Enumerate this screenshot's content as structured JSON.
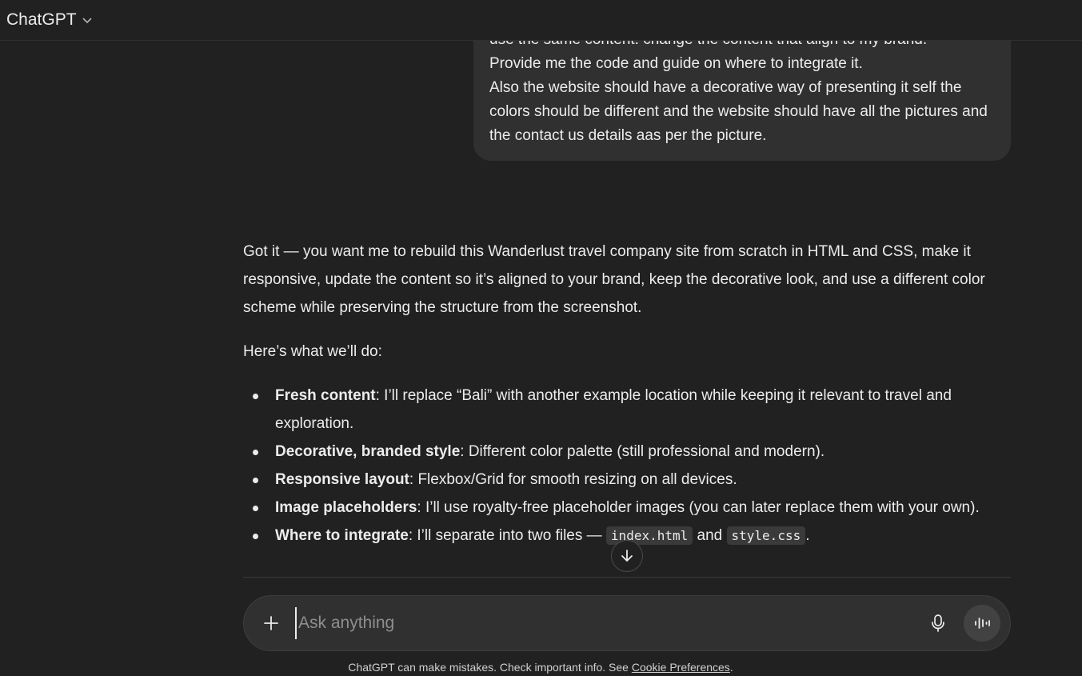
{
  "header": {
    "model_name": "ChatGPT"
  },
  "user_message": {
    "lines": [
      "use the same content. change the content that align to my brand.",
      "Provide me the code and guide on where to integrate it.",
      "Also the website should have a decorative way of presenting it self the colors should be different and the website should have all the pictures and the contact us details aas per the picture."
    ]
  },
  "assistant": {
    "intro": "Got it — you want me to rebuild this Wanderlust travel company site from scratch in HTML and CSS, make it responsive, update the content so it’s aligned to your brand, keep the decorative look, and use a different color scheme while preserving the structure from the screenshot.",
    "lead": "Here’s what we’ll do:",
    "bullets": [
      {
        "bold": "Fresh content",
        "text": ": I’ll replace “Bali” with another example location while keeping it relevant to travel and exploration."
      },
      {
        "bold": "Decorative, branded style",
        "text": ": Different color palette (still professional and modern)."
      },
      {
        "bold": "Responsive layout",
        "text": ": Flexbox/Grid for smooth resizing on all devices."
      },
      {
        "bold": "Image placeholders",
        "text": ": I’ll use royalty-free placeholder images (you can later replace them with your own)."
      },
      {
        "bold": "Where to integrate",
        "text_before": ": I’ll separate into two files — ",
        "code1": "index.html",
        "text_mid": " and ",
        "code2": "style.css",
        "text_after": "."
      }
    ]
  },
  "composer": {
    "placeholder": "Ask anything"
  },
  "footer": {
    "note": "ChatGPT can make mistakes. Check important info. See ",
    "link": "Cookie Preferences",
    "end": "."
  },
  "icons": [
    "chevron-down-icon",
    "arrow-down-icon",
    "plus-icon",
    "microphone-icon",
    "voice-mode-icon"
  ],
  "colors": {
    "background": "#212121",
    "bubble": "#303030",
    "text": "#ececec",
    "muted": "#8e8e8e"
  }
}
